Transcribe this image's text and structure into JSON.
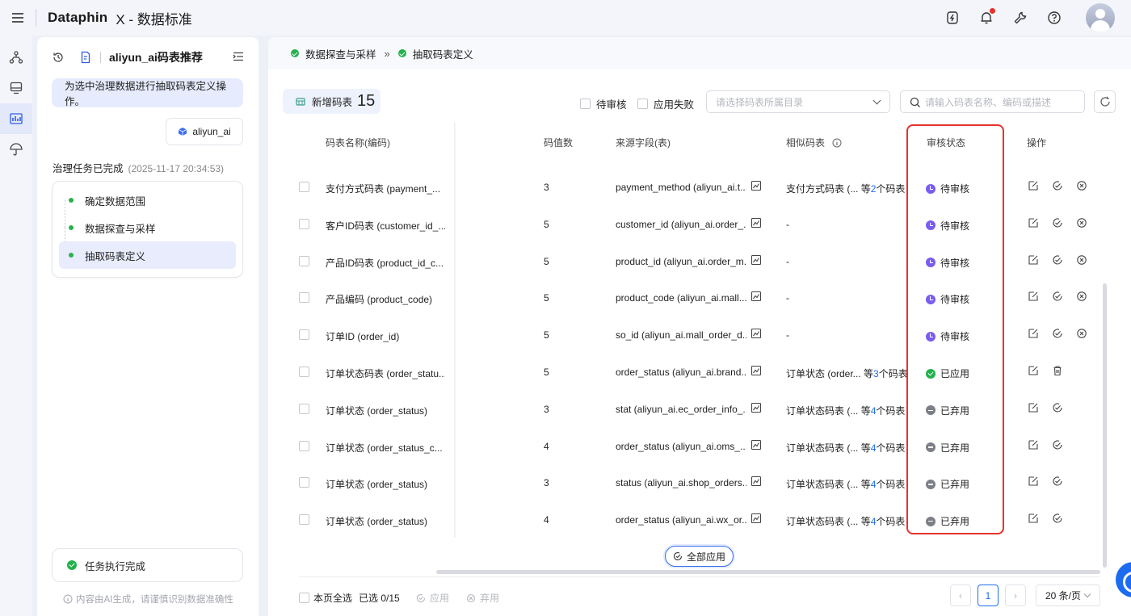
{
  "app": {
    "logo": "Dataphin",
    "module": "X - 数据标准"
  },
  "topbar_icons": [
    "shortcut-icon",
    "bell-icon",
    "tools-icon",
    "help-icon",
    "avatar"
  ],
  "leftnav": [
    "topology-icon",
    "monitor-icon",
    "chart-icon",
    "umbrella-icon"
  ],
  "sidepanel": {
    "title": "aliyun_ai码表推荐",
    "prompt": "为选中治理数据进行抽取码表定义操作。",
    "chip": "aliyun_ai",
    "task_done": "治理任务已完成",
    "task_time": "(2025-11-17 20:34:53)",
    "steps": [
      "确定数据范围",
      "数据探查与采样",
      "抽取码表定义"
    ],
    "exec_done": "任务执行完成",
    "ai_note": "内容由AI生成，请谨慎识别数据准确性"
  },
  "breadcrumb": {
    "step1": "数据探查与采样",
    "sep": "»",
    "step2": "抽取码表定义"
  },
  "toolbar": {
    "new_label": "新增码表",
    "new_count": "15",
    "filter_pending": "待审核",
    "filter_failed": "应用失败",
    "dir_placeholder": "请选择码表所属目录",
    "search_placeholder": "请输入码表名称、编码或描述"
  },
  "table": {
    "columns": {
      "name": "码表名称(编码)",
      "count": "码值数",
      "source": "来源字段(表)",
      "similar": "相似码表",
      "status": "审核状态",
      "ops": "操作"
    },
    "rows": [
      {
        "name": "支付方式码表 (payment_...",
        "count": "3",
        "source": "payment_method (aliyun_ai.t...",
        "similar": "支付方式码表 (...",
        "similar_pre": "等",
        "similar_num": "2",
        "similar_post": "个码表",
        "status": "待审核",
        "status_type": "pending"
      },
      {
        "name": "客户ID码表 (customer_id_...",
        "count": "5",
        "source": "customer_id (aliyun_ai.order_...",
        "similar": "-",
        "similar_pre": "",
        "similar_num": "",
        "similar_post": "",
        "status": "待审核",
        "status_type": "pending"
      },
      {
        "name": "产品ID码表 (product_id_c...",
        "count": "5",
        "source": "product_id (aliyun_ai.order_m...",
        "similar": "-",
        "similar_pre": "",
        "similar_num": "",
        "similar_post": "",
        "status": "待审核",
        "status_type": "pending"
      },
      {
        "name": "产品编码 (product_code)",
        "count": "5",
        "source": "product_code (aliyun_ai.mall...",
        "similar": "-",
        "similar_pre": "",
        "similar_num": "",
        "similar_post": "",
        "status": "待审核",
        "status_type": "pending"
      },
      {
        "name": "订单ID (order_id)",
        "count": "5",
        "source": "so_id (aliyun_ai.mall_order_d...",
        "similar": "-",
        "similar_pre": "",
        "similar_num": "",
        "similar_post": "",
        "status": "待审核",
        "status_type": "pending"
      },
      {
        "name": "订单状态码表 (order_statu...",
        "count": "5",
        "source": "order_status (aliyun_ai.brand...",
        "similar": "订单状态 (order...",
        "similar_pre": "等",
        "similar_num": "3",
        "similar_post": "个码表",
        "status": "已应用",
        "status_type": "applied"
      },
      {
        "name": "订单状态 (order_status)",
        "count": "3",
        "source": "stat (aliyun_ai.ec_order_info_...",
        "similar": "订单状态码表 (...",
        "similar_pre": "等",
        "similar_num": "4",
        "similar_post": "个码表",
        "status": "已弃用",
        "status_type": "abandoned"
      },
      {
        "name": "订单状态 (order_status_c...",
        "count": "4",
        "source": "order_status (aliyun_ai.oms_...",
        "similar": "订单状态码表 (...",
        "similar_pre": "等",
        "similar_num": "4",
        "similar_post": "个码表",
        "status": "已弃用",
        "status_type": "abandoned"
      },
      {
        "name": "订单状态 (order_status)",
        "count": "3",
        "source": "status (aliyun_ai.shop_orders...",
        "similar": "订单状态码表 (...",
        "similar_pre": "等",
        "similar_num": "4",
        "similar_post": "个码表",
        "status": "已弃用",
        "status_type": "abandoned"
      },
      {
        "name": "订单状态 (order_status)",
        "count": "4",
        "source": "order_status (aliyun_ai.wx_or...",
        "similar": "订单状态码表 (...",
        "similar_pre": "等",
        "similar_num": "4",
        "similar_post": "个码表",
        "status": "已弃用",
        "status_type": "abandoned"
      }
    ]
  },
  "apply_all": "全部应用",
  "footer": {
    "select_page": "本页全选",
    "selected": "已选 0/15",
    "apply": "应用",
    "abandon": "弃用",
    "page": "1",
    "page_size": "20 条/页"
  },
  "colors": {
    "accent": "#1d6cf0",
    "highlight_box": "#e5322d",
    "pending": "#7a5cf0",
    "applied": "#22b14c",
    "abandoned": "#7c7f88"
  }
}
